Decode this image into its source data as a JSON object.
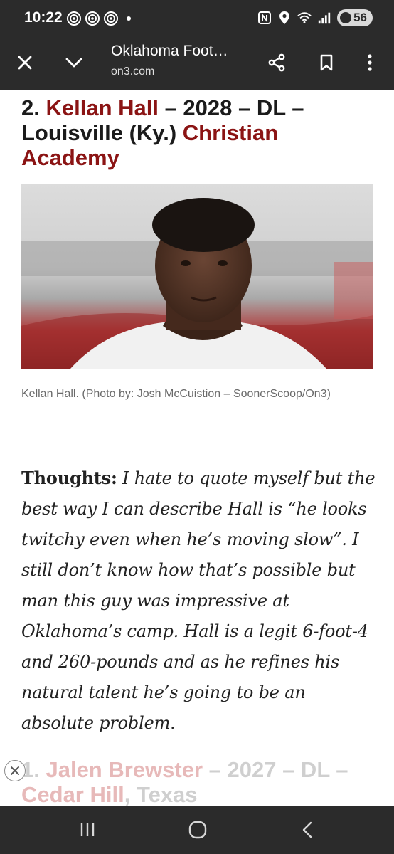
{
  "status_bar": {
    "time": "10:22",
    "battery_level": "56",
    "icons": [
      "notification-icon",
      "notification-icon",
      "notification-icon",
      "nfc-icon",
      "location-icon",
      "wifi-icon",
      "signal-icon"
    ]
  },
  "toolbar": {
    "page_title": "Oklahoma Foot…",
    "url": "on3.com",
    "icons": [
      "close-icon",
      "chevron-down-icon",
      "share-icon",
      "bookmark-icon",
      "more-vert-icon"
    ]
  },
  "article": {
    "headline": {
      "rank": "2. ",
      "name": "Kellan Hall",
      "meta": " – 2028 – DL – Louisville (Ky.) ",
      "school": "Christian Academy"
    },
    "photo_caption": "Kellan Hall. (Photo by: Josh McCuistion – SoonerScoop/On3)",
    "thoughts_label": "Thoughts:",
    "thoughts_text": " I hate to quote myself but the best way I can describe Hall is “he looks twitchy even when he’s moving slow”. I still don’t know how that’s possible but man this guy was impressive at Oklahoma’s camp. Hall is a legit 6-foot-4 and 260-pounds and as he refines his natural talent he’s going to be an absolute problem.",
    "next_headline": {
      "rank": "1. ",
      "name": "Jalen Brewster",
      "meta": " – 2027 – DL – ",
      "school": "Cedar Hill",
      "tail": ", Texas"
    }
  },
  "colors": {
    "accent_red": "#8b1414",
    "bar_dark": "#2b2b2b"
  }
}
